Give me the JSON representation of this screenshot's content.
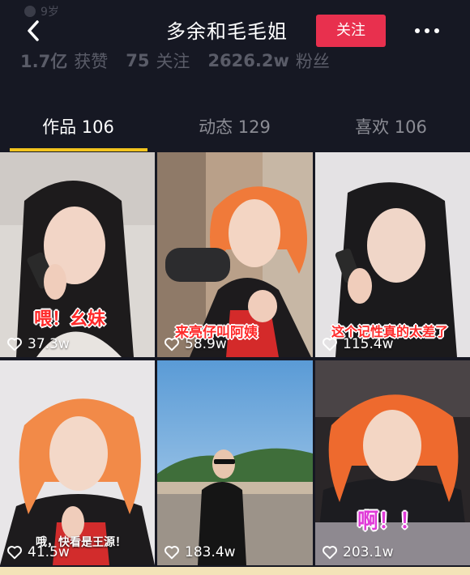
{
  "header": {
    "age_text": "9岁",
    "title": "多余和毛毛姐",
    "follow_label": "关注",
    "stats": [
      {
        "num": "1.7亿",
        "label": "获赞"
      },
      {
        "num": "75",
        "label": "关注"
      },
      {
        "num": "2626.2w",
        "label": "粉丝"
      }
    ]
  },
  "tabs": [
    {
      "label": "作品 106",
      "active": true
    },
    {
      "label": "动态 129",
      "active": false
    },
    {
      "label": "喜欢 106",
      "active": false
    }
  ],
  "videos": [
    {
      "caption": "喂！幺妹",
      "likes": "37.3w"
    },
    {
      "caption": "来亮仔叫阿姨",
      "likes": "58.9w"
    },
    {
      "caption": "这个记性真的太差了",
      "likes": "115.4w"
    },
    {
      "caption": "哦，快看是王源！",
      "likes": "41.5w"
    },
    {
      "caption": "",
      "likes": "183.4w"
    },
    {
      "caption": "啊！！",
      "likes": "203.1w"
    }
  ],
  "colors": {
    "background": "#161823",
    "follow_button": "#e8304e",
    "tab_underline": "#f2c41e"
  }
}
